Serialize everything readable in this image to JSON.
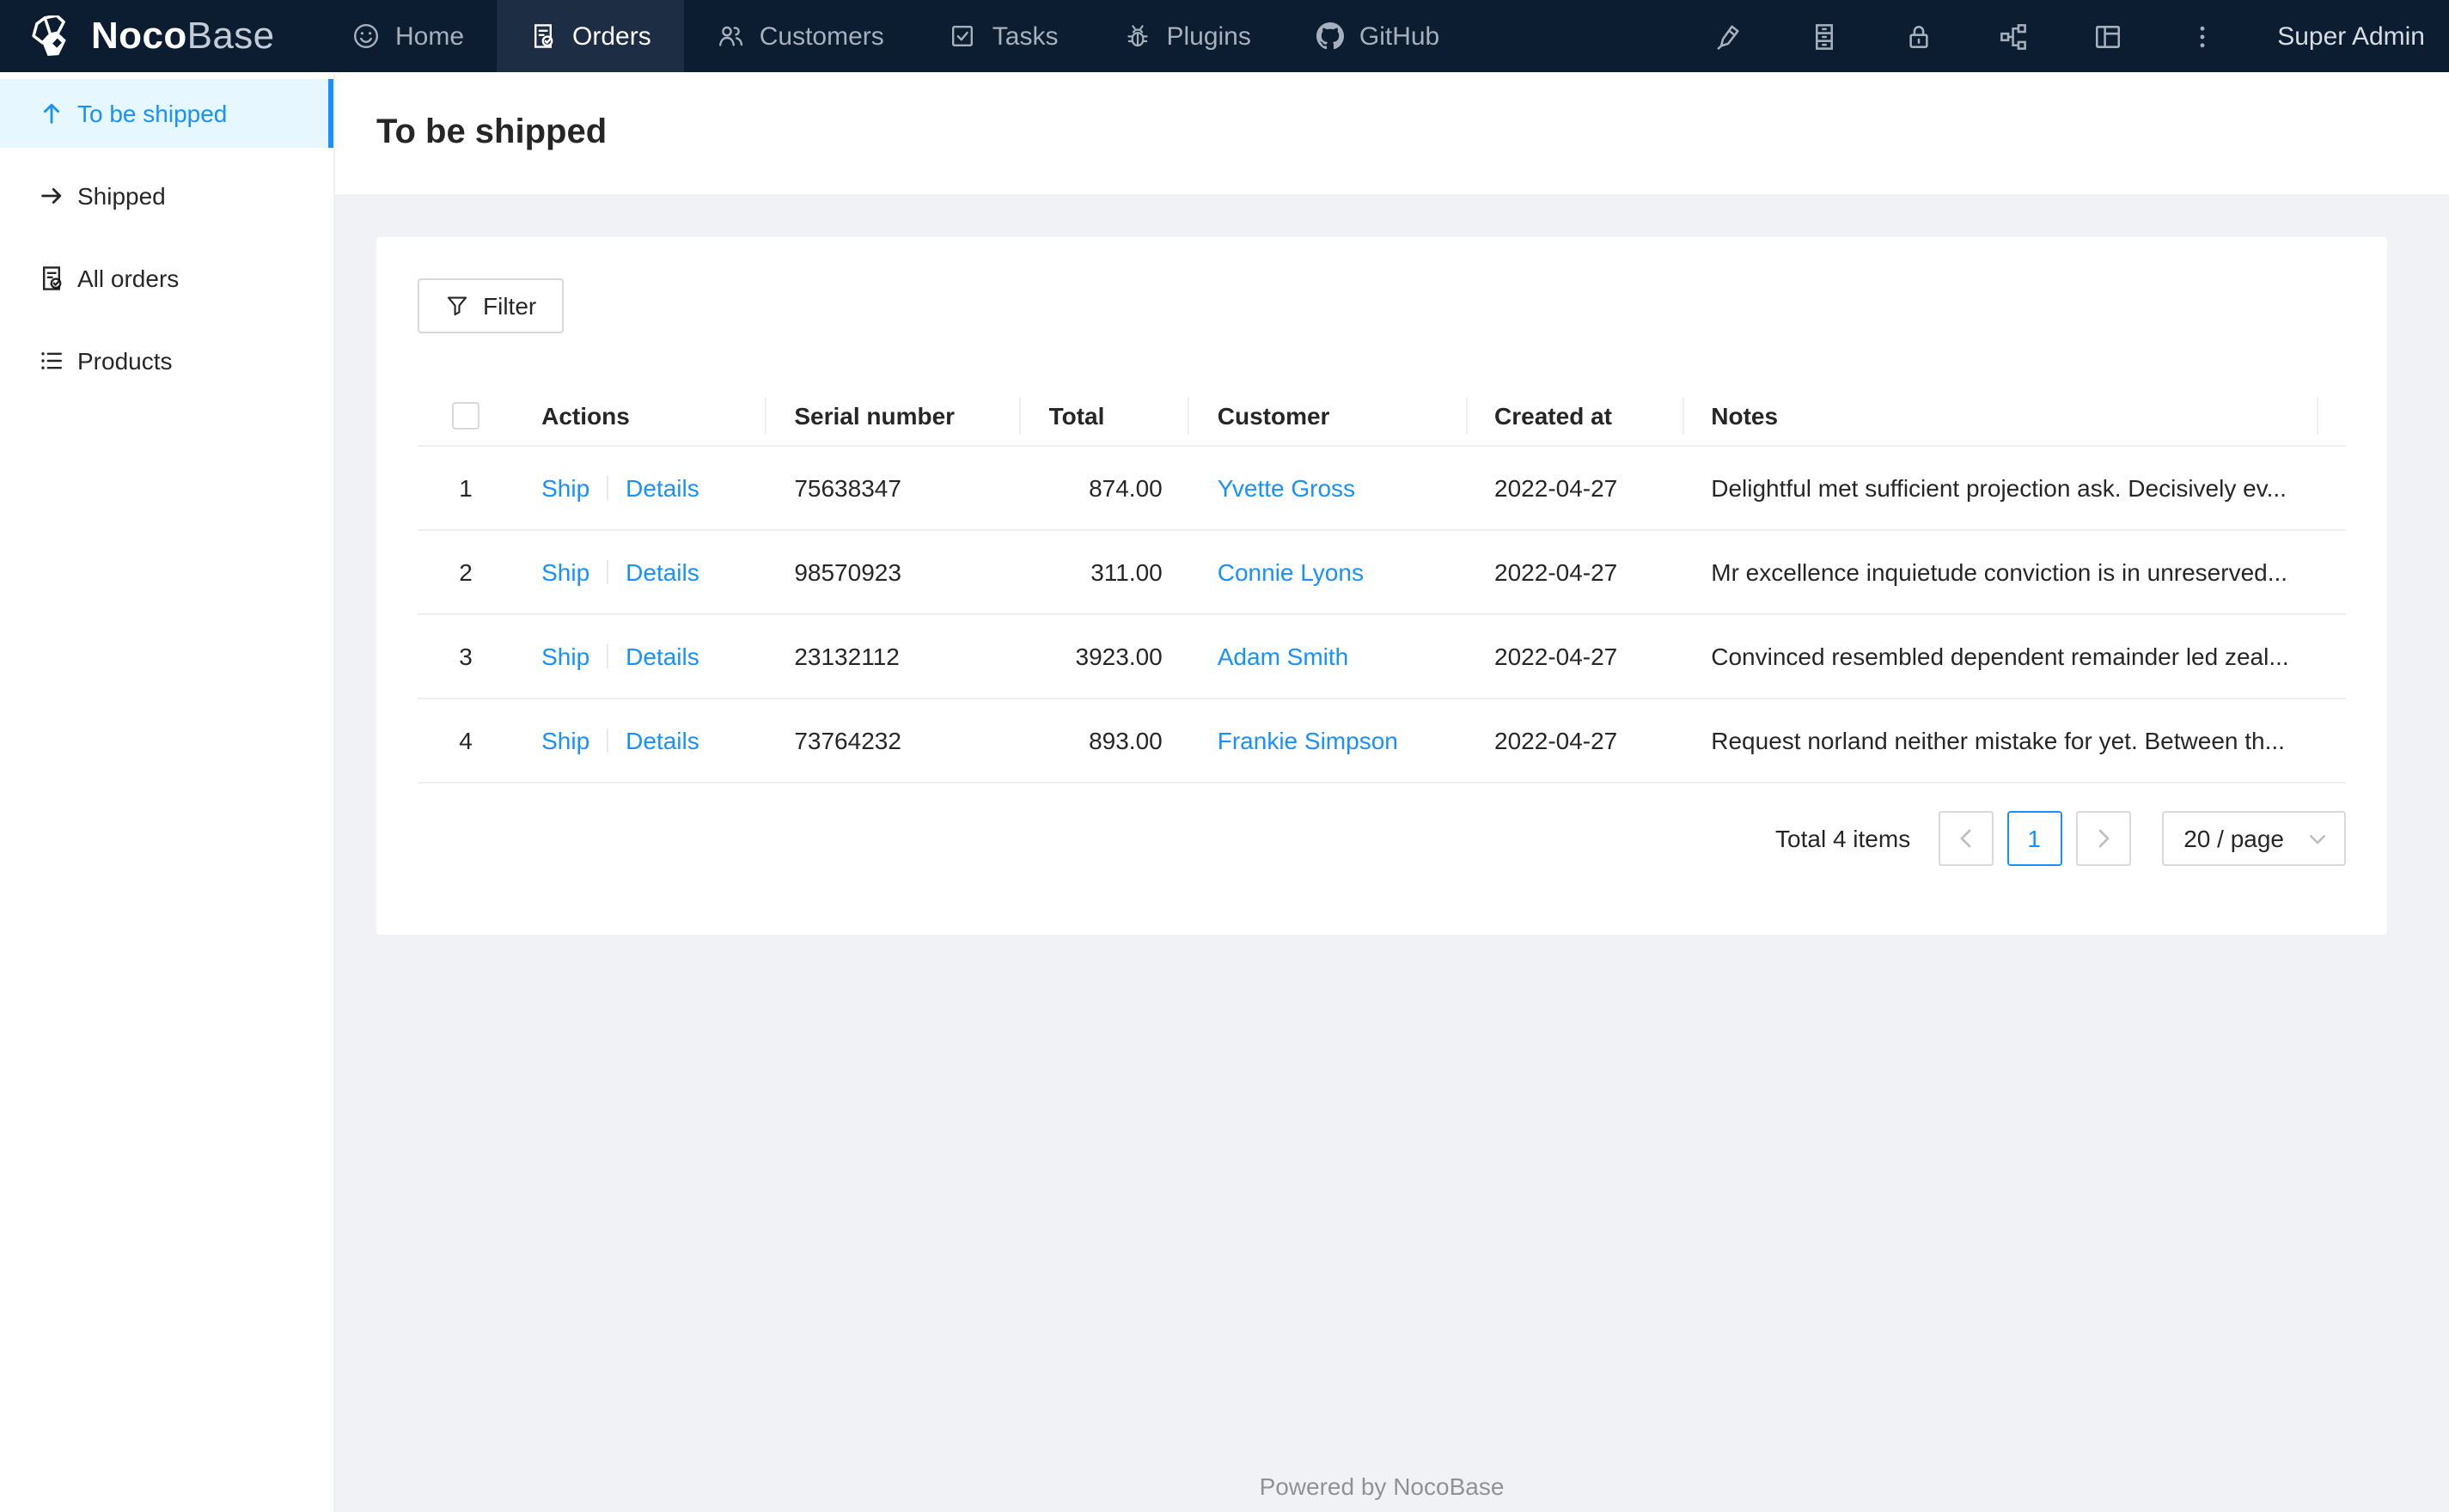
{
  "navbar": {
    "logo": {
      "brand_bold": "Noco",
      "brand_light": "Base"
    },
    "tabs": [
      {
        "label": "Home",
        "icon": "smile-icon",
        "active": false
      },
      {
        "label": "Orders",
        "icon": "order-check-icon",
        "active": true
      },
      {
        "label": "Customers",
        "icon": "customers-icon",
        "active": false
      },
      {
        "label": "Tasks",
        "icon": "check-square-icon",
        "active": false
      },
      {
        "label": "Plugins",
        "icon": "bug-icon",
        "active": false
      },
      {
        "label": "GitHub",
        "icon": "github-icon",
        "active": false
      }
    ],
    "utility_icons": [
      "highlighter-icon",
      "database-icon",
      "lock-icon",
      "api-icon",
      "layout-icon",
      "more-icon"
    ],
    "user": "Super Admin"
  },
  "sidebar": {
    "items": [
      {
        "label": "To be shipped",
        "icon": "arrow-up-icon",
        "active": true
      },
      {
        "label": "Shipped",
        "icon": "arrow-right-icon",
        "active": false
      },
      {
        "label": "All orders",
        "icon": "order-check-icon",
        "active": false
      },
      {
        "label": "Products",
        "icon": "list-icon",
        "active": false
      }
    ]
  },
  "page": {
    "title": "To be shipped"
  },
  "toolbar": {
    "filter_label": "Filter",
    "filter_icon": "filter-icon"
  },
  "table": {
    "columns": [
      "",
      "Actions",
      "Serial number",
      "Total",
      "Customer",
      "Created at",
      "Notes"
    ],
    "action_labels": {
      "ship": "Ship",
      "details": "Details"
    },
    "rows": [
      {
        "index": "1",
        "serial": "75638347",
        "total": "874.00",
        "customer": "Yvette Gross",
        "created_at": "2022-04-27",
        "notes": "Delightful met sufficient projection ask. Decisively ev..."
      },
      {
        "index": "2",
        "serial": "98570923",
        "total": "311.00",
        "customer": "Connie Lyons",
        "created_at": "2022-04-27",
        "notes": "Mr excellence inquietude conviction is in unreserved..."
      },
      {
        "index": "3",
        "serial": "23132112",
        "total": "3923.00",
        "customer": "Adam Smith",
        "created_at": "2022-04-27",
        "notes": "Convinced resembled dependent remainder led zeal..."
      },
      {
        "index": "4",
        "serial": "73764232",
        "total": "893.00",
        "customer": "Frankie Simpson",
        "created_at": "2022-04-27",
        "notes": "Request norland neither mistake for yet. Between th..."
      }
    ]
  },
  "pagination": {
    "total_text": "Total 4 items",
    "current_page": "1",
    "page_size": "20 / page"
  },
  "footer": {
    "text": "Powered by NocoBase"
  },
  "colors": {
    "accent": "#1890ff",
    "navbar_bg": "#0c1d31",
    "navbar_active_bg": "#1d2e44",
    "sidebar_active_bg": "#e6f7ff",
    "page_bg": "#f0f2f5",
    "link": "#1890ff"
  }
}
